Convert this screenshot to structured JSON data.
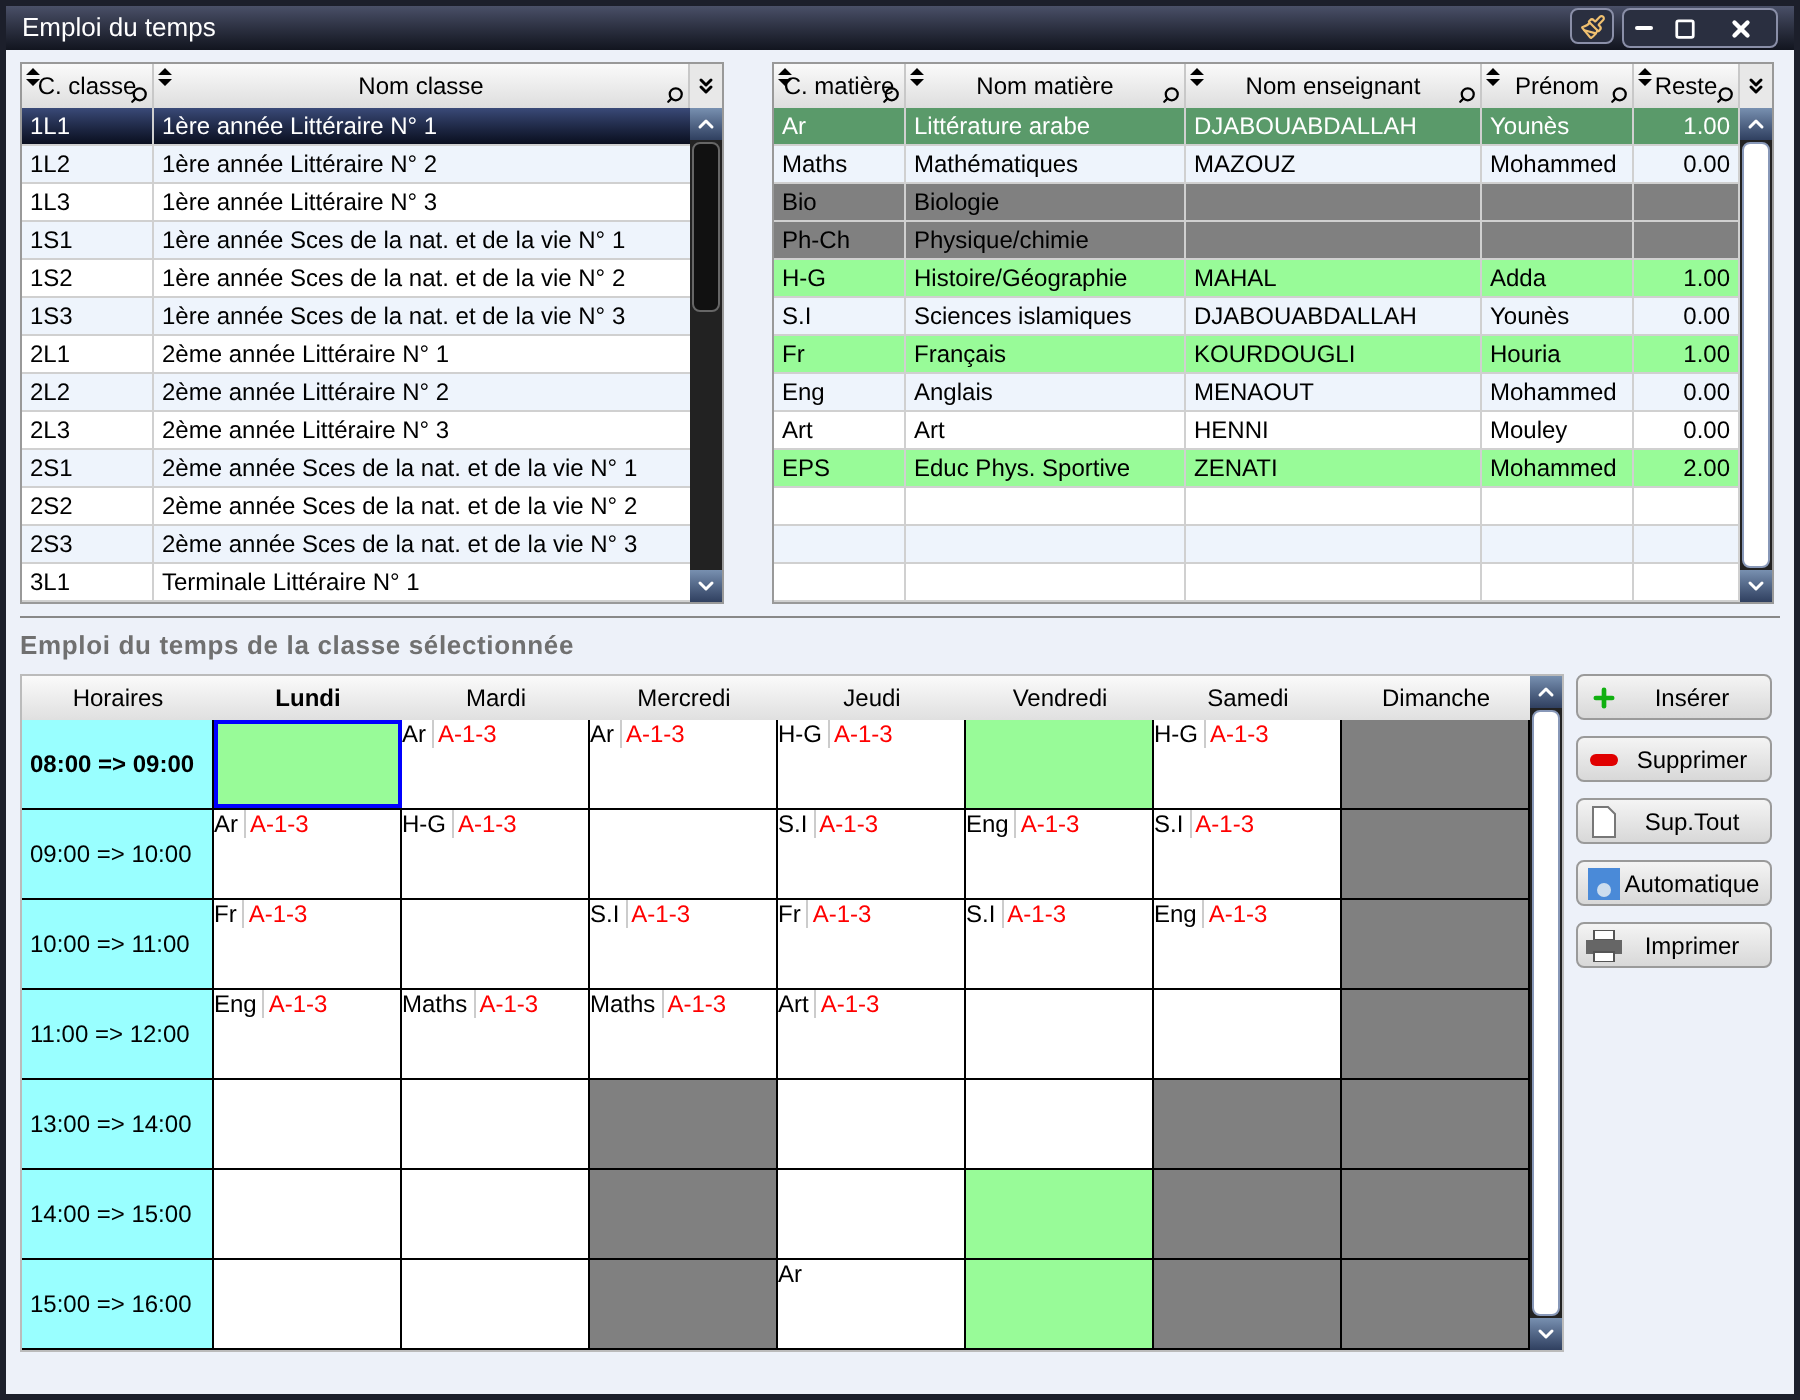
{
  "window": {
    "title": "Emploi du temps"
  },
  "classes": {
    "columns": [
      {
        "label": "C. classe"
      },
      {
        "label": "Nom classe"
      }
    ],
    "rows": [
      {
        "code": "1L1",
        "name": "1ère année Littéraire N° 1",
        "selected": true
      },
      {
        "code": "1L2",
        "name": "1ère année Littéraire N° 2",
        "selected": false
      },
      {
        "code": "1L3",
        "name": "1ère année Littéraire N° 3",
        "selected": false
      },
      {
        "code": "1S1",
        "name": "1ère année Sces de la nat. et de la vie N° 1",
        "selected": false
      },
      {
        "code": "1S2",
        "name": "1ère année Sces de la nat. et de la vie N° 2",
        "selected": false
      },
      {
        "code": "1S3",
        "name": "1ère année Sces de la nat. et de la vie N° 3",
        "selected": false
      },
      {
        "code": "2L1",
        "name": "2ème année Littéraire N° 1",
        "selected": false
      },
      {
        "code": "2L2",
        "name": "2ème année Littéraire N° 2",
        "selected": false
      },
      {
        "code": "2L3",
        "name": "2ème année Littéraire N° 3",
        "selected": false
      },
      {
        "code": "2S1",
        "name": "2ème année Sces de la nat. et de la vie N° 1",
        "selected": false
      },
      {
        "code": "2S2",
        "name": "2ème année Sces de la nat. et de la vie N° 2",
        "selected": false
      },
      {
        "code": "2S3",
        "name": "2ème année Sces de la nat. et de la vie N° 3",
        "selected": false
      },
      {
        "code": "3L1",
        "name": "Terminale Littéraire N° 1",
        "selected": false
      }
    ]
  },
  "subjects": {
    "columns": [
      {
        "label": "C. matière"
      },
      {
        "label": "Nom matière"
      },
      {
        "label": "Nom enseignant"
      },
      {
        "label": "Prénom"
      },
      {
        "label": "Reste"
      }
    ],
    "rows": [
      {
        "code": "Ar",
        "name": "Littérature arabe",
        "teacher": "DJABOUABDALLAH",
        "first_name": "Younès",
        "remaining": "1.00",
        "kind": "pending",
        "selected": true
      },
      {
        "code": "Maths",
        "name": "Mathématiques",
        "teacher": "MAZOUZ",
        "first_name": "Mohammed",
        "remaining": "0.00",
        "kind": "done",
        "selected": false
      },
      {
        "code": "Bio",
        "name": "Biologie",
        "kind": "unassigned",
        "selected": false
      },
      {
        "code": "Ph-Ch",
        "name": "Physique/chimie",
        "kind": "unassigned",
        "selected": false
      },
      {
        "code": "H-G",
        "name": "Histoire/Géographie",
        "teacher": "MAHAL",
        "first_name": "Adda",
        "remaining": "1.00",
        "kind": "pending",
        "selected": false
      },
      {
        "code": "S.I",
        "name": "Sciences islamiques",
        "teacher": "DJABOUABDALLAH",
        "first_name": "Younès",
        "remaining": "0.00",
        "kind": "done",
        "selected": false
      },
      {
        "code": "Fr",
        "name": "Français",
        "teacher": "KOURDOUGLI",
        "first_name": "Houria",
        "remaining": "1.00",
        "kind": "pending",
        "selected": false
      },
      {
        "code": "Eng",
        "name": "Anglais",
        "teacher": "MENAOUT",
        "first_name": "Mohammed",
        "remaining": "0.00",
        "kind": "done",
        "selected": false
      },
      {
        "code": "Art",
        "name": "Art",
        "teacher": "HENNI",
        "first_name": "Mouley",
        "remaining": "0.00",
        "kind": "done",
        "selected": false
      },
      {
        "code": "EPS",
        "name": "Educ Phys. Sportive",
        "teacher": "ZENATI",
        "first_name": "Mohammed",
        "remaining": "2.00",
        "kind": "pending",
        "selected": false
      }
    ]
  },
  "timetable": {
    "title": "Emploi du temps de la classe sélectionnée",
    "corner": "Horaires",
    "days": [
      {
        "label": "Lundi"
      },
      {
        "label": "Mardi"
      },
      {
        "label": "Mercredi"
      },
      {
        "label": "Jeudi"
      },
      {
        "label": "Vendredi"
      },
      {
        "label": "Samedi"
      },
      {
        "label": "Dimanche"
      }
    ],
    "rows": [
      {
        "time": "08:00 => 09:00",
        "cells": [
          {
            "kind": "available",
            "selected": true
          },
          {
            "kind": "free",
            "subject": "Ar",
            "room": "A-1-3",
            "selected": false
          },
          {
            "kind": "free",
            "subject": "Ar",
            "room": "A-1-3",
            "selected": false
          },
          {
            "kind": "free",
            "subject": "H-G",
            "room": "A-1-3",
            "selected": false
          },
          {
            "kind": "available",
            "selected": false
          },
          {
            "kind": "free",
            "subject": "H-G",
            "room": "A-1-3",
            "selected": false
          },
          {
            "kind": "blocked",
            "selected": false
          }
        ]
      },
      {
        "time": "09:00 => 10:00",
        "cells": [
          {
            "kind": "free",
            "subject": "Ar",
            "room": "A-1-3",
            "selected": false
          },
          {
            "kind": "free",
            "subject": "H-G",
            "room": "A-1-3",
            "selected": false
          },
          {
            "kind": "free",
            "selected": false
          },
          {
            "kind": "free",
            "subject": "S.I",
            "room": "A-1-3",
            "selected": false
          },
          {
            "kind": "free",
            "subject": "Eng",
            "room": "A-1-3",
            "selected": false
          },
          {
            "kind": "free",
            "subject": "S.I",
            "room": "A-1-3",
            "selected": false
          },
          {
            "kind": "blocked",
            "selected": false
          }
        ]
      },
      {
        "time": "10:00 => 11:00",
        "cells": [
          {
            "kind": "free",
            "subject": "Fr",
            "room": "A-1-3",
            "selected": false
          },
          {
            "kind": "free",
            "selected": false
          },
          {
            "kind": "free",
            "subject": "S.I",
            "room": "A-1-3",
            "selected": false
          },
          {
            "kind": "free",
            "subject": "Fr",
            "room": "A-1-3",
            "selected": false
          },
          {
            "kind": "free",
            "subject": "S.I",
            "room": "A-1-3",
            "selected": false
          },
          {
            "kind": "free",
            "subject": "Eng",
            "room": "A-1-3",
            "selected": false
          },
          {
            "kind": "blocked",
            "selected": false
          }
        ]
      },
      {
        "time": "11:00 => 12:00",
        "cells": [
          {
            "kind": "free",
            "subject": "Eng",
            "room": "A-1-3",
            "selected": false
          },
          {
            "kind": "free",
            "subject": "Maths",
            "room": "A-1-3",
            "selected": false
          },
          {
            "kind": "free",
            "subject": "Maths",
            "room": "A-1-3",
            "selected": false
          },
          {
            "kind": "free",
            "subject": "Art",
            "room": "A-1-3",
            "selected": false
          },
          {
            "kind": "free",
            "selected": false
          },
          {
            "kind": "free",
            "selected": false
          },
          {
            "kind": "blocked",
            "selected": false
          }
        ]
      },
      {
        "time": "13:00 => 14:00",
        "cells": [
          {
            "kind": "free",
            "selected": false
          },
          {
            "kind": "free",
            "selected": false
          },
          {
            "kind": "blocked",
            "selected": false
          },
          {
            "kind": "free",
            "selected": false
          },
          {
            "kind": "free",
            "selected": false
          },
          {
            "kind": "blocked",
            "selected": false
          },
          {
            "kind": "blocked",
            "selected": false
          }
        ]
      },
      {
        "time": "14:00 => 15:00",
        "cells": [
          {
            "kind": "free",
            "selected": false
          },
          {
            "kind": "free",
            "selected": false
          },
          {
            "kind": "blocked",
            "selected": false
          },
          {
            "kind": "free",
            "selected": false
          },
          {
            "kind": "available",
            "selected": false
          },
          {
            "kind": "blocked",
            "selected": false
          },
          {
            "kind": "blocked",
            "selected": false
          }
        ]
      },
      {
        "time": "15:00 => 16:00",
        "cells": [
          {
            "kind": "free",
            "selected": false
          },
          {
            "kind": "free",
            "selected": false
          },
          {
            "kind": "blocked",
            "selected": false
          },
          {
            "kind": "free",
            "subject": "Ar",
            "selected": false
          },
          {
            "kind": "available",
            "selected": false
          },
          {
            "kind": "blocked",
            "selected": false
          },
          {
            "kind": "blocked",
            "selected": false
          }
        ]
      }
    ]
  },
  "actions": [
    {
      "label": "Insérer",
      "kind": "insert"
    },
    {
      "label": "Supprimer",
      "kind": "delete"
    },
    {
      "label": "Sup.Tout",
      "kind": "clear"
    },
    {
      "label": "Automatique",
      "kind": "auto"
    },
    {
      "label": "Imprimer",
      "kind": "print"
    }
  ]
}
